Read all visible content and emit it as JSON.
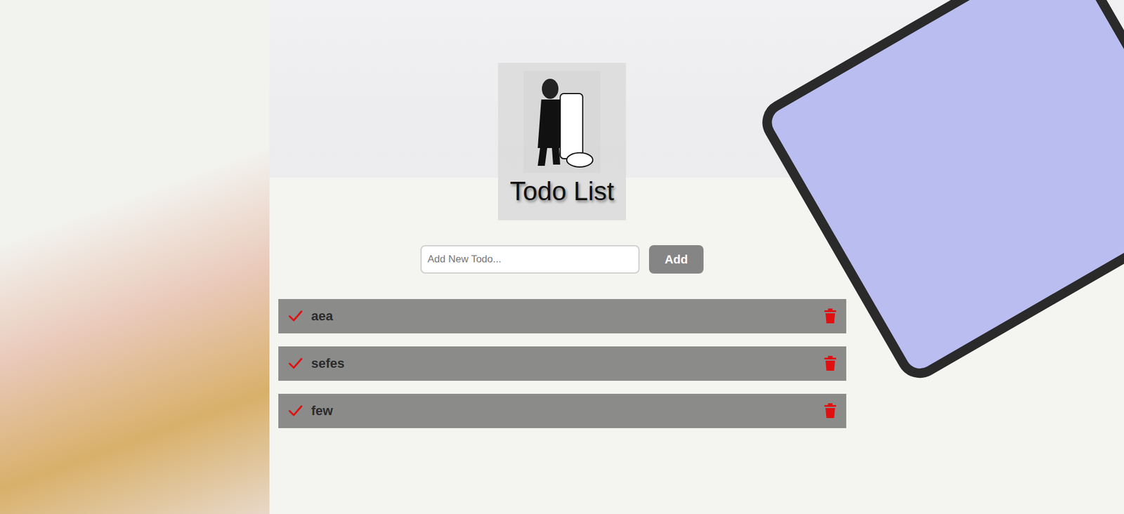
{
  "app": {
    "title": "Todo List"
  },
  "form": {
    "placeholder": "Add New Todo...",
    "button": "Add"
  },
  "todos": [
    {
      "text": "aea"
    },
    {
      "text": "sefes"
    },
    {
      "text": "few"
    }
  ]
}
